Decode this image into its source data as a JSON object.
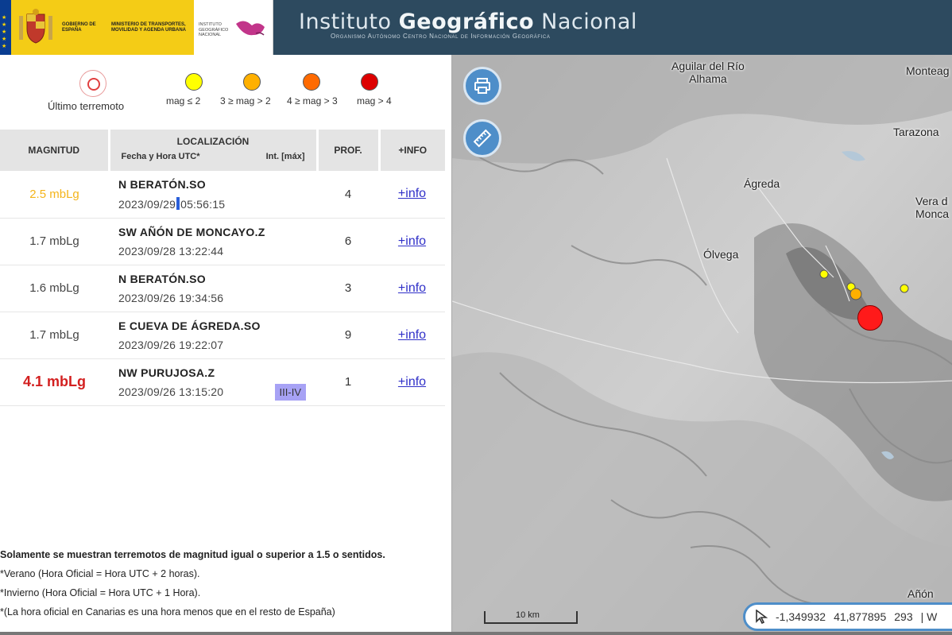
{
  "header": {
    "gob_text": "GOBIERNO DE ESPAÑA",
    "ministry_text": "MINISTERIO DE TRANSPORTES, MOVILIDAD Y AGENDA URBANA",
    "ign_small": "INSTITUTO GEOGRÁFICO NACIONAL",
    "title_pre": "Instituto ",
    "title_bold": "Geográfico",
    "title_post": " Nacional",
    "subtitle": "Organismo Autónomo Centro Nacional de Información Geográfica"
  },
  "legend": {
    "last_quake": "Último terremoto",
    "items": [
      {
        "label": "mag ≤ 2",
        "color": "#ffff00"
      },
      {
        "label": "3 ≥ mag > 2",
        "color": "#ffb000"
      },
      {
        "label": "4 ≥ mag > 3",
        "color": "#ff6a00"
      },
      {
        "label": "mag > 4",
        "color": "#dd0000"
      }
    ]
  },
  "table": {
    "headers": {
      "magnitude": "MAGNITUD",
      "location": "LOCALIZACIÓN",
      "datetime": "Fecha y Hora UTC*",
      "intensity": "Int. [máx]",
      "depth": "PROF.",
      "info": "+INFO"
    },
    "rows": [
      {
        "mag": "2.5 mbLg",
        "place": "N BERATÓN.SO",
        "date": "2023/09/29",
        "time": "05:56:15",
        "intensity": "",
        "depth": "4",
        "info": "+info"
      },
      {
        "mag": "1.7 mbLg",
        "place": "SW AÑÓN DE MONCAYO.Z",
        "date": "2023/09/28",
        "time": "13:22:44",
        "intensity": "",
        "depth": "6",
        "info": "+info"
      },
      {
        "mag": "1.6 mbLg",
        "place": "N BERATÓN.SO",
        "date": "2023/09/26",
        "time": "19:34:56",
        "intensity": "",
        "depth": "3",
        "info": "+info"
      },
      {
        "mag": "1.7 mbLg",
        "place": "E CUEVA DE ÁGREDA.SO",
        "date": "2023/09/26",
        "time": "19:22:07",
        "intensity": "",
        "depth": "9",
        "info": "+info"
      },
      {
        "mag": "4.1 mbLg",
        "place": "NW PURUJOSA.Z",
        "date": "2023/09/26",
        "time": "13:15:20",
        "intensity": "III-IV",
        "depth": "1",
        "info": "+info"
      }
    ]
  },
  "notes": {
    "bold": "Solamente se muestran terremotos de magnitud igual o superior a 1.5 o sentidos.",
    "summer": "*Verano (Hora Oficial = Hora UTC + 2 horas).",
    "winter": "*Invierno (Hora Oficial = Hora UTC + 1 Hora).",
    "canarias": "*(La hora oficial en Canarias es una hora menos que en el resto de España)"
  },
  "map": {
    "print_icon": "printer-icon",
    "measure_icon": "ruler-icon",
    "towns": {
      "aguilar": "Aguilar del Río",
      "aguilar2": "Alhama",
      "monteagudo": "Monteag",
      "tarazona": "Tarazona",
      "agreda": "Ágreda",
      "vera": "Vera d",
      "vera2": "Monca",
      "olvega": "Ólvega",
      "anon": "Añón"
    },
    "scale": "10 km",
    "coords": {
      "lon": "-1,349932",
      "lat": "41,877895",
      "alt": "293",
      "sep": "| W"
    }
  }
}
